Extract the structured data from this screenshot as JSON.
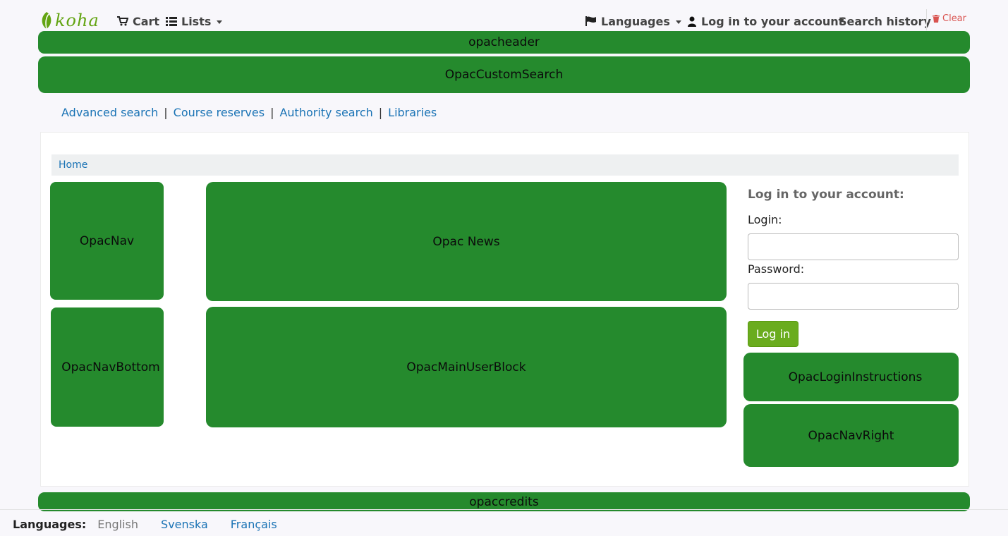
{
  "header": {
    "logo_text": "koha",
    "cart_label": "Cart",
    "lists_label": "Lists",
    "languages_label": "Languages",
    "login_link_label": "Log in to your account",
    "search_history_label": "Search history",
    "clear_label": "Clear"
  },
  "blocks": {
    "opacheader": "opacheader",
    "custom_search": "OpacCustomSearch",
    "nav": "OpacNav",
    "nav_bottom": "OpacNavBottom",
    "news": "Opac News",
    "main_user_block": "OpacMainUserBlock",
    "login_instructions": "OpacLoginInstructions",
    "nav_right": "OpacNavRight",
    "credits": "opaccredits"
  },
  "links": {
    "advanced_search": "Advanced search",
    "course_reserves": "Course reserves",
    "authority_search": "Authority search",
    "libraries": "Libraries",
    "separator": "|"
  },
  "breadcrumb": {
    "home": "Home"
  },
  "login": {
    "title": "Log in to your account:",
    "login_label": "Login:",
    "password_label": "Password:",
    "login_value": "",
    "password_value": "",
    "button_label": "Log in"
  },
  "footer": {
    "languages_label": "Languages:",
    "current_language": "English",
    "other_languages": [
      "Svenska",
      "Français"
    ]
  },
  "colors": {
    "block_green": "#258a2d",
    "brand_green": "#63a412",
    "link_blue": "#1a73b5",
    "clear_red": "#d9534f",
    "button_green": "#6aac1e"
  }
}
